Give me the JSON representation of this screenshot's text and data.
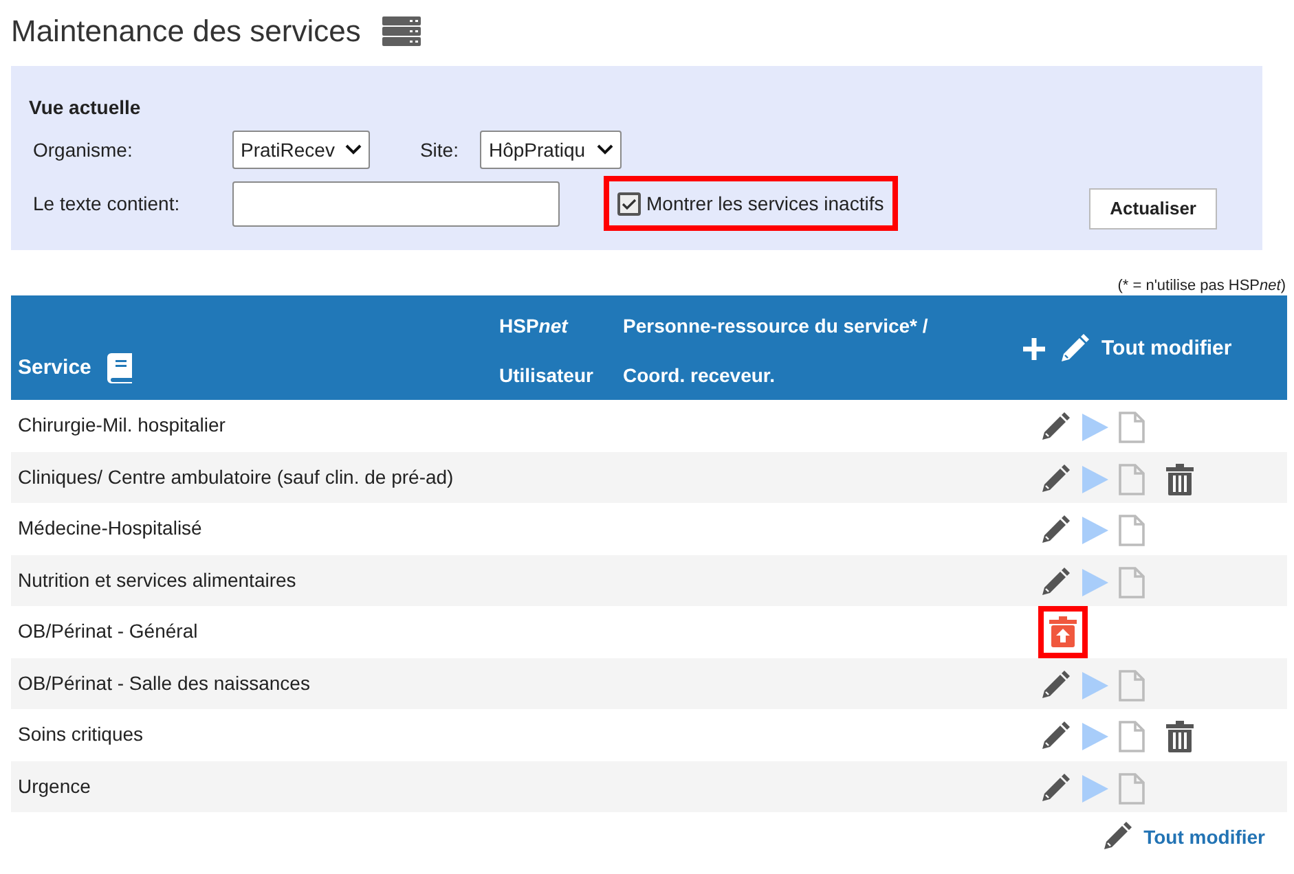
{
  "title": "Maintenance des services",
  "filter": {
    "heading": "Vue actuelle",
    "organism_label": "Organisme:",
    "organism_value": "PratiRecev",
    "site_label": "Site:",
    "site_value": "HôpPratiqu",
    "text_label": "Le texte contient:",
    "show_inactive": {
      "label": "Montrer les services inactifs",
      "checked": true,
      "highlighted": true
    },
    "refresh_button": "Actualiser"
  },
  "footnote": {
    "before": "(* = n'utilise pas HSP",
    "italic": "net",
    "after": ")"
  },
  "table": {
    "columns": [
      {
        "label": "Service"
      },
      {
        "label": "HSP",
        "italic": "net",
        "label2": "Utilisateur"
      },
      {
        "label": "Personne-ressource du service* /",
        "label2": "Coord. receveur."
      },
      {
        "label": "Tout modifier"
      }
    ],
    "rows": [
      {
        "service": "Chirurgie-Mil. hospitalier",
        "inactive": false,
        "deletable": false
      },
      {
        "service": "Cliniques/ Centre ambulatoire (sauf clin. de pré-ad)",
        "inactive": false,
        "deletable": true
      },
      {
        "service": "Médecine-Hospitalisé",
        "inactive": false,
        "deletable": false
      },
      {
        "service": "Nutrition et services alimentaires",
        "inactive": false,
        "deletable": false
      },
      {
        "service": "OB/Périnat - Général",
        "inactive": true,
        "highlighted": true
      },
      {
        "service": "OB/Périnat - Salle des naissances",
        "inactive": false,
        "deletable": false
      },
      {
        "service": "Soins critiques",
        "inactive": false,
        "deletable": true
      },
      {
        "service": "Urgence",
        "inactive": false,
        "deletable": false
      }
    ]
  },
  "footer_link": "Tout modifier"
}
